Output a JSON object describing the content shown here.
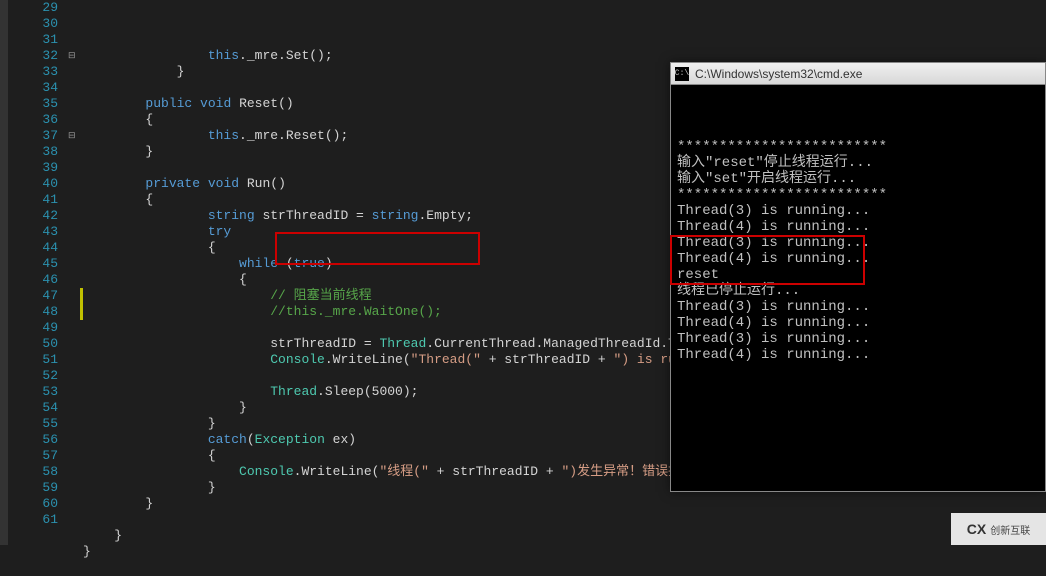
{
  "line_start": 29,
  "line_end": 61,
  "code_lines": [
    {
      "n": 29,
      "indent": 4,
      "tokens": [
        [
          "kw",
          "this"
        ],
        [
          "punc",
          "._mre.Set();"
        ]
      ]
    },
    {
      "n": 30,
      "indent": 3,
      "tokens": [
        [
          "punc",
          "}"
        ]
      ]
    },
    {
      "n": 31,
      "indent": 0,
      "tokens": []
    },
    {
      "n": 32,
      "indent": 2,
      "fold": "⊟",
      "tokens": [
        [
          "kw",
          "public"
        ],
        [
          "punc",
          " "
        ],
        [
          "kw",
          "void"
        ],
        [
          "punc",
          " Reset()"
        ]
      ]
    },
    {
      "n": 33,
      "indent": 2,
      "tokens": [
        [
          "punc",
          "{"
        ]
      ]
    },
    {
      "n": 34,
      "indent": 4,
      "tokens": [
        [
          "kw",
          "this"
        ],
        [
          "punc",
          "._mre.Reset();"
        ]
      ]
    },
    {
      "n": 35,
      "indent": 2,
      "tokens": [
        [
          "punc",
          "}"
        ]
      ]
    },
    {
      "n": 36,
      "indent": 0,
      "tokens": []
    },
    {
      "n": 37,
      "indent": 2,
      "fold": "⊟",
      "tokens": [
        [
          "kw",
          "private"
        ],
        [
          "punc",
          " "
        ],
        [
          "kw",
          "void"
        ],
        [
          "punc",
          " Run()"
        ]
      ]
    },
    {
      "n": 38,
      "indent": 2,
      "tokens": [
        [
          "punc",
          "{"
        ]
      ]
    },
    {
      "n": 39,
      "indent": 4,
      "tokens": [
        [
          "kw",
          "string"
        ],
        [
          "punc",
          " strThreadID = "
        ],
        [
          "kw",
          "string"
        ],
        [
          "punc",
          ".Empty;"
        ]
      ]
    },
    {
      "n": 40,
      "indent": 4,
      "tokens": [
        [
          "kw",
          "try"
        ]
      ]
    },
    {
      "n": 41,
      "indent": 4,
      "tokens": [
        [
          "punc",
          "{"
        ]
      ]
    },
    {
      "n": 42,
      "indent": 5,
      "tokens": [
        [
          "kw",
          "while"
        ],
        [
          "punc",
          " ("
        ],
        [
          "kw",
          "true"
        ],
        [
          "punc",
          ")"
        ]
      ]
    },
    {
      "n": 43,
      "indent": 5,
      "tokens": [
        [
          "punc",
          "{"
        ]
      ]
    },
    {
      "n": 44,
      "indent": 6,
      "modified": true,
      "tokens": [
        [
          "comment",
          "// 阻塞当前线程"
        ]
      ]
    },
    {
      "n": 45,
      "indent": 6,
      "modified": true,
      "tokens": [
        [
          "comment",
          "//this._mre.WaitOne();"
        ]
      ]
    },
    {
      "n": 46,
      "indent": 0,
      "tokens": []
    },
    {
      "n": 47,
      "indent": 6,
      "tokens": [
        [
          "punc",
          "strThreadID = "
        ],
        [
          "type",
          "Thread"
        ],
        [
          "punc",
          ".CurrentThread.ManagedThreadId.ToString();"
        ]
      ]
    },
    {
      "n": 48,
      "indent": 6,
      "tokens": [
        [
          "type",
          "Console"
        ],
        [
          "punc",
          ".WriteLine("
        ],
        [
          "str",
          "\"Thread(\""
        ],
        [
          "punc",
          " + strThreadID + "
        ],
        [
          "str",
          "\") is running...\""
        ],
        [
          "punc",
          ");"
        ]
      ]
    },
    {
      "n": 49,
      "indent": 0,
      "tokens": []
    },
    {
      "n": 50,
      "indent": 6,
      "tokens": [
        [
          "type",
          "Thread"
        ],
        [
          "punc",
          ".Sleep(5000);"
        ]
      ]
    },
    {
      "n": 51,
      "indent": 5,
      "tokens": [
        [
          "punc",
          "}"
        ]
      ]
    },
    {
      "n": 52,
      "indent": 4,
      "tokens": [
        [
          "punc",
          "}"
        ]
      ]
    },
    {
      "n": 53,
      "indent": 4,
      "tokens": [
        [
          "kw",
          "catch"
        ],
        [
          "punc",
          "("
        ],
        [
          "type",
          "Exception"
        ],
        [
          "punc",
          " ex)"
        ]
      ]
    },
    {
      "n": 54,
      "indent": 4,
      "tokens": [
        [
          "punc",
          "{"
        ]
      ]
    },
    {
      "n": 55,
      "indent": 5,
      "tokens": [
        [
          "type",
          "Console"
        ],
        [
          "punc",
          ".WriteLine("
        ],
        [
          "str",
          "\"线程(\""
        ],
        [
          "punc",
          " + strThreadID + "
        ],
        [
          "str",
          "\")发生异常！错误描述：\""
        ],
        [
          "punc",
          " + "
        ]
      ]
    },
    {
      "n": 56,
      "indent": 4,
      "tokens": [
        [
          "punc",
          "}"
        ]
      ]
    },
    {
      "n": 57,
      "indent": 2,
      "tokens": [
        [
          "punc",
          "}"
        ]
      ]
    },
    {
      "n": 58,
      "indent": 0,
      "tokens": []
    },
    {
      "n": 59,
      "indent": 1,
      "tokens": [
        [
          "punc",
          "}"
        ]
      ]
    },
    {
      "n": 60,
      "indent": 0,
      "tokens": [
        [
          "punc",
          "}"
        ]
      ]
    },
    {
      "n": 61,
      "indent": 0,
      "tokens": []
    }
  ],
  "cmd": {
    "title": "C:\\Windows\\system32\\cmd.exe",
    "lines": [
      "*************************",
      "输入\"reset\"停止线程运行...",
      "输入\"set\"开启线程运行...",
      "*************************",
      "",
      "Thread(3) is running...",
      "Thread(4) is running...",
      "Thread(3) is running...",
      "Thread(4) is running...",
      "reset",
      "线程已停止运行...",
      "Thread(3) is running...",
      "Thread(4) is running...",
      "Thread(3) is running...",
      "Thread(4) is running..."
    ]
  },
  "watermark": {
    "logo": "CX",
    "text": "创新互联"
  }
}
